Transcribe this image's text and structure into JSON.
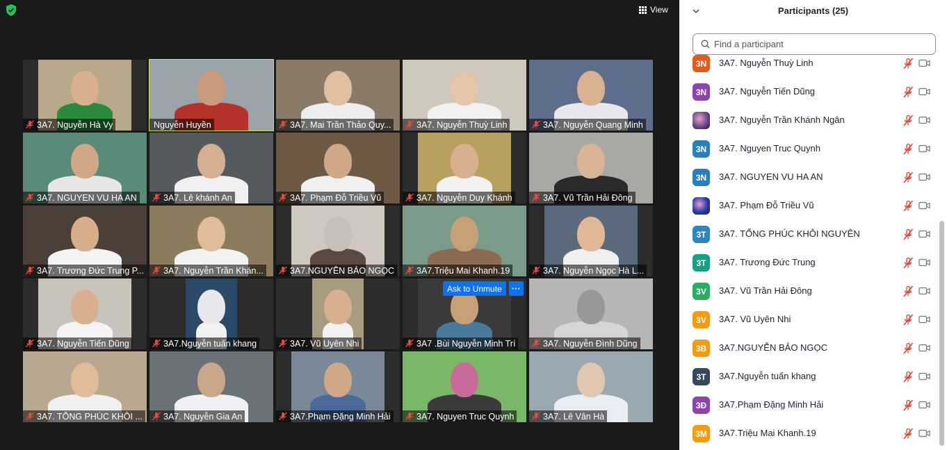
{
  "toolbar": {
    "view_label": "View"
  },
  "tiles": [
    {
      "name": "3A7. Nguyễn Hà Vy",
      "muted": true,
      "bg": "#b8a98a",
      "skin": "#d9b08e",
      "shirt": "#2b8a3e",
      "vl": 22,
      "vw": 134
    },
    {
      "name": "Nguyễn Huyền",
      "muted": false,
      "bg": "#9aa3a8",
      "skin": "#c99b7a",
      "shirt": "#b5322b",
      "vl": 0,
      "vw": 178,
      "active": true
    },
    {
      "name": "3A7. Mai Trần Thảo Quy...",
      "muted": true,
      "bg": "#8a7a68",
      "skin": "#e0c0a0",
      "shirt": "#eeeeee",
      "vl": 0,
      "vw": 178
    },
    {
      "name": "3A7. Nguyễn Thuỳ Linh",
      "muted": true,
      "bg": "#cfc8bc",
      "skin": "#e5c5a8",
      "shirt": "#f2f2f2",
      "vl": 0,
      "vw": 178
    },
    {
      "name": "3A7. Nguyễn Quang Minh",
      "muted": true,
      "bg": "#5e6d8c",
      "skin": "#d8b290",
      "shirt": "#e8e8ec",
      "vl": 0,
      "vw": 178
    },
    {
      "name": "3A7. NGUYEN VU HA AN",
      "muted": true,
      "bg": "#5a8a78",
      "skin": "#d0a888",
      "shirt": "#e6e6e6",
      "vl": 0,
      "vw": 178
    },
    {
      "name": "3A7. Lê khánh An",
      "muted": true,
      "bg": "#555a5e",
      "skin": "#d5b090",
      "shirt": "#f0f0f0",
      "vl": 0,
      "vw": 178
    },
    {
      "name": "3A7. Phạm Đỗ Triều Vũ",
      "muted": true,
      "bg": "#6e5a44",
      "skin": "#d0a888",
      "shirt": "#f0f0f0",
      "vl": 0,
      "vw": 178
    },
    {
      "name": "3A7. Nguyễn Duy Khánh",
      "muted": true,
      "bg": "#b8a060",
      "skin": "#d8b090",
      "shirt": "#f2f2f2",
      "vl": 22,
      "vw": 134
    },
    {
      "name": "3A7. Vũ Trần Hải Đông",
      "muted": true,
      "bg": "#a8a8a4",
      "skin": "#d9b595",
      "shirt": "#2a2a2a",
      "vl": 0,
      "vw": 178
    },
    {
      "name": "3A7. Trương Đức Trung P...",
      "muted": true,
      "bg": "#4a4038",
      "skin": "#d8ae88",
      "shirt": "#f4f4f4",
      "vl": 0,
      "vw": 178
    },
    {
      "name": "3A7. Nguyễn Trần Khán...",
      "muted": true,
      "bg": "#8a7c5c",
      "skin": "#e0bc98",
      "shirt": "#f2f2f2",
      "vl": 0,
      "vw": 178
    },
    {
      "name": "3A7.NGUYỄN BẢO NGỌC",
      "muted": true,
      "bg": "#cfc8c0",
      "skin": "#c8c0b8",
      "shirt": "#5a4a40",
      "vl": 22,
      "vw": 134
    },
    {
      "name": "3A7.Triệu Mai Khanh.19",
      "muted": true,
      "bg": "#7a9a8a",
      "skin": "#c8a078",
      "shirt": "#8a6a50",
      "vl": 0,
      "vw": 178
    },
    {
      "name": "3A7. Nguyễn Ngọc Hà L...",
      "muted": true,
      "bg": "#5a6a7c",
      "skin": "#e0b898",
      "shirt": "#f0f0f0",
      "vl": 22,
      "vw": 134
    },
    {
      "name": "3A7. Nguyễn Tiến Dũng",
      "muted": true,
      "bg": "#c8c4bc",
      "skin": "#d8b090",
      "shirt": "#f4f4f4",
      "vl": 22,
      "vw": 134
    },
    {
      "name": "3A7.Nguyễn tuấn khang",
      "muted": true,
      "bg": "#2a4a6a",
      "skin": "#e8e8ec",
      "shirt": "#f2f2f2",
      "vl": 52,
      "vw": 74
    },
    {
      "name": "3A7. Vũ Uyên Nhi",
      "muted": true,
      "bg": "#a89c80",
      "skin": "#d8b090",
      "shirt": "#f2f2f2",
      "vl": 52,
      "vw": 74
    },
    {
      "name": "3A7 .Bùi Nguyễn Minh Trí",
      "muted": true,
      "bg": "#3a3a3a",
      "skin": "#c8a078",
      "shirt": "#4a7a9a",
      "vl": 22,
      "vw": 134
    },
    {
      "name": "3A7. Nguyễn Đình Dũng",
      "muted": true,
      "bg": "#b8b6b4",
      "skin": "#9a9896",
      "shirt": "#d8d6d4",
      "vl": 0,
      "vw": 178
    },
    {
      "name": "3A7. TỔNG PHÚC KHÔI ...",
      "muted": true,
      "bg": "#b8a890",
      "skin": "#e0bc98",
      "shirt": "#f0f0f0",
      "vl": 0,
      "vw": 178
    },
    {
      "name": "3A7. Nguyễn Gia An",
      "muted": true,
      "bg": "#6a7278",
      "skin": "#c8a888",
      "shirt": "#f0f0f4",
      "vl": 0,
      "vw": 178
    },
    {
      "name": "3A7.Phạm Đặng Minh Hải",
      "muted": true,
      "bg": "#7a8898",
      "skin": "#d0a888",
      "shirt": "#4a6a9a",
      "vl": 22,
      "vw": 134
    },
    {
      "name": "3A7. Nguyen Truc Quynh",
      "muted": true,
      "bg": "#78b868",
      "skin": "#c86a9a",
      "shirt": "#3a3a3a",
      "vl": 0,
      "vw": 178
    },
    {
      "name": "3A7. Lê Vân Hà",
      "muted": true,
      "bg": "#9aa8b0",
      "skin": "#e0c8b0",
      "shirt": "#e8eef4",
      "vl": 0,
      "vw": 178
    }
  ],
  "unmute_popup": {
    "label": "Ask to Unmute",
    "more": "···"
  },
  "panel": {
    "title": "Participants (25)",
    "search_placeholder": "Find a participant",
    "participants": [
      {
        "initials": "3N",
        "color": "#e35b1b",
        "name": "3A7. Nguyễn Thuỳ Linh"
      },
      {
        "initials": "3N",
        "color": "#8e44ad",
        "name": "3A7. Nguyễn Tiến Dũng"
      },
      {
        "initials": "",
        "color": "#6a4a8a",
        "name": "3A7. Nguyễn Trần Khánh Ngân",
        "photo": true
      },
      {
        "initials": "3N",
        "color": "#2980b9",
        "name": "3A7. Nguyen Truc Quynh"
      },
      {
        "initials": "3N",
        "color": "#2980b9",
        "name": "3A7. NGUYEN VU HA AN"
      },
      {
        "initials": "",
        "color": "#2a3aa8",
        "name": "3A7. Phạm Đỗ Triều Vũ",
        "photo": true
      },
      {
        "initials": "3T",
        "color": "#2e86c1",
        "name": "3A7. TỔNG PHÚC KHÔI NGUYÊN"
      },
      {
        "initials": "3T",
        "color": "#16a085",
        "name": "3A7. Trương Đức Trung"
      },
      {
        "initials": "3V",
        "color": "#27ae60",
        "name": "3A7. Vũ Trần Hải Đông"
      },
      {
        "initials": "3V",
        "color": "#f39c12",
        "name": "3A7. Vũ Uyên Nhi"
      },
      {
        "initials": "3B",
        "color": "#f39c12",
        "name": "3A7.NGUYỄN BẢO NGỌC"
      },
      {
        "initials": "3T",
        "color": "#34495e",
        "name": "3A7.Nguyễn tuấn khang"
      },
      {
        "initials": "3Đ",
        "color": "#8e44ad",
        "name": "3A7.Phạm Đặng Minh Hải"
      },
      {
        "initials": "3M",
        "color": "#f39c12",
        "name": "3A7.Triệu Mai Khanh.19"
      }
    ]
  }
}
